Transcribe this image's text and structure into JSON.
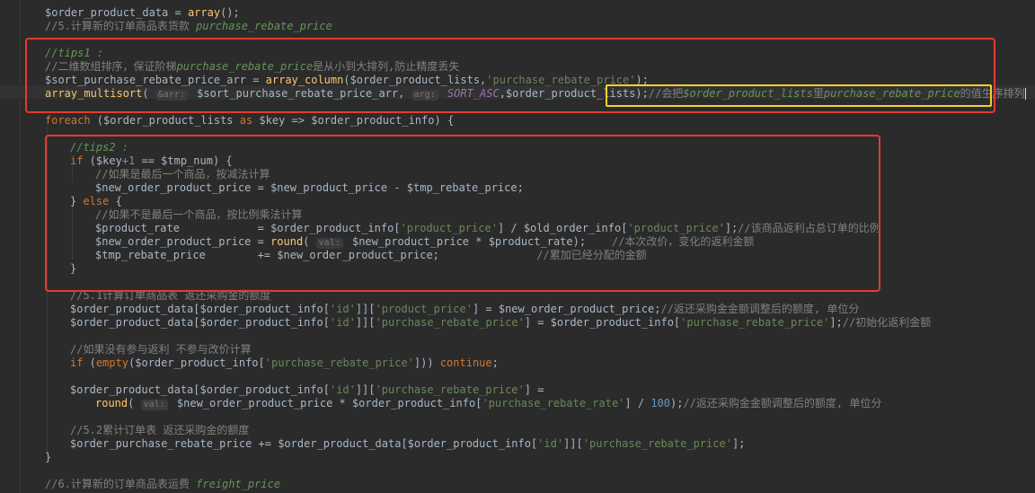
{
  "code": {
    "l1": {
      "a": "$order_product_data = ",
      "b": "array",
      "c": "();"
    },
    "l2": {
      "a": "//5.计算新的订单商品表货款 ",
      "b": "purchase_rebate_price"
    },
    "l3": {
      "a": "//tips1 :"
    },
    "l4": {
      "a": "//二维数组排序，保证阶梯",
      "b": "purchase_rebate_price",
      "c": "是从小到大排列,防止精度丢失"
    },
    "l5": {
      "a": "$sort_purchase_rebate_price_arr = ",
      "b": "array_column",
      "c": "($order_product_lists,",
      "d": "'purchase_rebate_price'",
      "e": ");"
    },
    "l6": {
      "a": "array_multisort",
      "b": "( ",
      "hint1": "&arr:",
      "c": " $sort_purchase_rebate_price_arr, ",
      "hint2": "arg:",
      "d": " SORT_ASC",
      "e": ",$order_product_lists);",
      "f": "//会把",
      "g": "$order_product_lists",
      "h": "里",
      "i": "purchase_rebate_price",
      "j": "的值生序排列"
    },
    "l7": {
      "a": "foreach",
      "b": " ($order_product_lists ",
      "c": "as",
      "d": " $key => $order_product_info) {"
    },
    "l8": {
      "a": "//tips2 :"
    },
    "l9": {
      "a": "if",
      "b": " ($key",
      "c": "+1",
      "d": " == $tmp_num) {"
    },
    "l10": {
      "a": "//如果是最后一个商品，按减法计算"
    },
    "l11": {
      "a": "$new_order_product_price = $new_product_price - $tmp_rebate_price;"
    },
    "l12": {
      "a": "} ",
      "b": "else",
      "c": " {"
    },
    "l13": {
      "a": "//如果不是最后一个商品，按比例乘法计算"
    },
    "l14": {
      "a": "$product_rate            = $order_product_info[",
      "b": "'product_price'",
      "c": "] / $old_order_info[",
      "d": "'product_price'",
      "e": "];",
      "f": "//该商品返利占总订单的比例"
    },
    "l15": {
      "a": "$new_order_product_price = ",
      "b": "round",
      "c": "( ",
      "hint": "val:",
      "d": " $new_product_price * $product_rate);    ",
      "e": "//本次改价，变化的返利金额"
    },
    "l16": {
      "a": "$tmp_rebate_price        += $new_order_product_price;               ",
      "b": "//累加已经分配的金额"
    },
    "l17": {
      "a": "}"
    },
    "l18": {
      "a": "//5.1计算订单商品表 返还采购金的额度"
    },
    "l19": {
      "a": "$order_product_data[$order_product_info[",
      "b": "'id'",
      "c": "]][",
      "d": "'product_price'",
      "e": "] = $new_order_product_price;",
      "f": "//返还采购金金额调整后的额度, 单位分"
    },
    "l20": {
      "a": "$order_product_data[$order_product_info[",
      "b": "'id'",
      "c": "]][",
      "d": "'purchase_rebate_price'",
      "e": "] = $order_product_info[",
      "f": "'purchase_rebate_price'",
      "g": "];",
      "h": "//初始化返利金额"
    },
    "l21": {
      "a": "//如果没有参与返利 不参与改价计算"
    },
    "l22": {
      "a": "if",
      "b": " (",
      "c": "empty",
      "d": "($order_product_info[",
      "e": "'purchase_rebate_price'",
      "f": "])) ",
      "g": "continue",
      "h": ";"
    },
    "l23": {
      "a": "$order_product_data[$order_product_info[",
      "b": "'id'",
      "c": "]][",
      "d": "'purchase_rebate_price'",
      "e": "] ="
    },
    "l24": {
      "a": "round",
      "b": "( ",
      "hint": "val:",
      "c": " $new_order_product_price * $order_product_info[",
      "d": "'purchase_rebate_rate'",
      "e": "] / ",
      "f": "100",
      "g": ");",
      "h": "//返还采购金金额调整后的额度, 单位分"
    },
    "l25": {
      "a": "//5.2累计订单表 返还采购金的额度"
    },
    "l26": {
      "a": "$order_purchase_rebate_price += $order_product_data[$order_product_info[",
      "b": "'id'",
      "c": "]][",
      "d": "'purchase_rebate_price'",
      "e": "];"
    },
    "l27": {
      "a": "}"
    },
    "l28": {
      "a": "//6.计算新的订单商品表运费 ",
      "b": "freight_price"
    }
  },
  "annotation_colors": {
    "red": "#e23b2e",
    "yellow": "#f2d230"
  }
}
